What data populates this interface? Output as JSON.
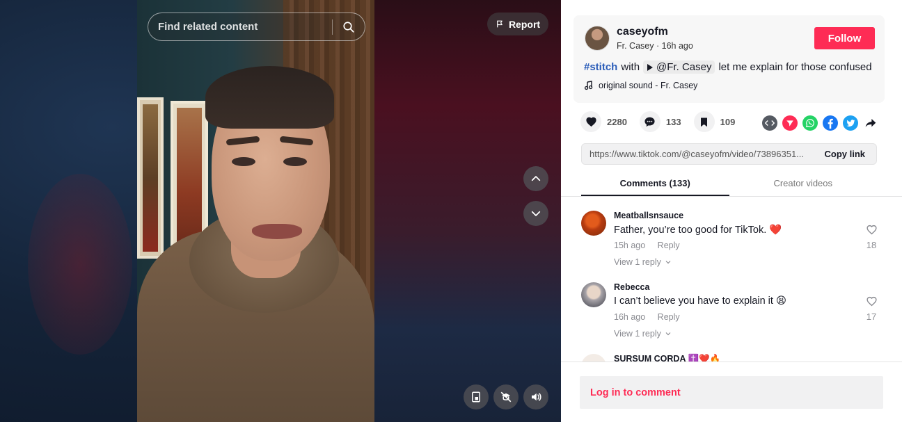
{
  "video": {
    "search": {
      "placeholder": "Find related content"
    },
    "report_label": "Report"
  },
  "post": {
    "author": {
      "username": "caseyofm",
      "display_name": "Fr. Casey",
      "time_ago": "16h ago",
      "separator": "·"
    },
    "follow_label": "Follow",
    "description": {
      "hashtag": "#stitch",
      "with": "with",
      "mention": "@Fr. Casey",
      "text": "let me explain for those confused"
    },
    "sound": "original sound - Fr. Casey",
    "stats": {
      "likes": "2280",
      "comments": "133",
      "saves": "109"
    },
    "share_icons": [
      "embed-icon",
      "send-icon",
      "whatsapp-icon",
      "facebook-icon",
      "twitter-icon",
      "share-arrow-icon"
    ],
    "link": "https://www.tiktok.com/@caseyofm/video/73896351...",
    "copy_link_label": "Copy link"
  },
  "tabs": [
    {
      "label": "Comments (133)",
      "active": true
    },
    {
      "label": "Creator videos",
      "active": false
    }
  ],
  "comments": [
    {
      "user": "Meatballsnsauce",
      "text": "Father, you’re too good for TikTok.",
      "emoji": "❤️",
      "time": "15h ago",
      "reply": "Reply",
      "view_replies": "View 1 reply",
      "likes": "18"
    },
    {
      "user": "Rebecca",
      "text": "I can’t believe you have to explain it",
      "emoji": "😫",
      "time": "16h ago",
      "reply": "Reply",
      "view_replies": "View 1 reply",
      "likes": "17"
    },
    {
      "user": "SURSUM CORDA ✝️❤️🔥"
    }
  ],
  "login_prompt": "Log in to comment",
  "colors": {
    "accent": "#fe2c55",
    "hashtag": "#2b5db9",
    "text": "#161823"
  }
}
